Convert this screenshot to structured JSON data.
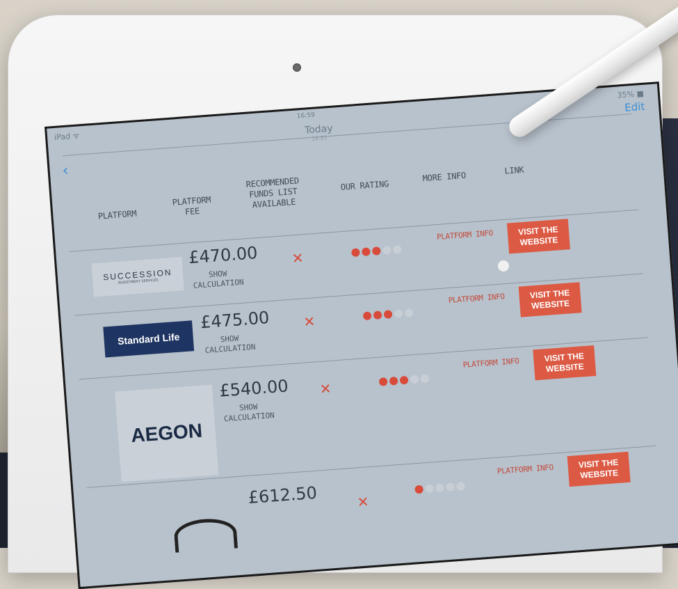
{
  "statusbar": {
    "device": "iPad ᯤ",
    "time": "16:59",
    "battery": "35% ■"
  },
  "nav": {
    "title": "Today",
    "subtitle": "16:51",
    "edit": "Edit",
    "back_icon": "chevron-left-icon"
  },
  "headers": {
    "platform": "PLATFORM",
    "platform_fee": "PLATFORM\nFEE",
    "recommended": "RECOMMENDED\nFUNDS LIST\nAVAILABLE",
    "our_rating": "OUR RATING",
    "more_info": "MORE INFO",
    "link": "LINK"
  },
  "rows": [
    {
      "logo": "SUCCESSION",
      "logo_sub": "INVESTMENT SERVICES",
      "fee": "£470.00",
      "show": "SHOW\nCALCULATION",
      "funds_icon": "cross-icon",
      "rating": 3,
      "rating_max": 5,
      "info": "PLATFORM INFO",
      "visit": "VISIT THE\nWEBSITE"
    },
    {
      "logo": "Standard Life",
      "fee": "£475.00",
      "show": "SHOW\nCALCULATION",
      "funds_icon": "cross-icon",
      "rating": 3,
      "rating_max": 5,
      "info": "PLATFORM INFO",
      "visit": "VISIT THE\nWEBSITE"
    },
    {
      "logo": "AEGON",
      "fee": "£540.00",
      "show": "SHOW\nCALCULATION",
      "funds_icon": "cross-icon",
      "rating": 3,
      "rating_max": 5,
      "info": "PLATFORM INFO",
      "visit": "VISIT THE\nWEBSITE"
    },
    {
      "logo": "",
      "fee": "£612.50",
      "show": "",
      "funds_icon": "cross-icon",
      "rating": 1,
      "rating_max": 5,
      "info": "PLATFORM INFO",
      "visit": "VISIT THE\nWEBSITE"
    }
  ],
  "colors": {
    "accent": "#dc5a44",
    "link_blue": "#3b8ed6",
    "screen_bg": "#b8c2cc"
  }
}
